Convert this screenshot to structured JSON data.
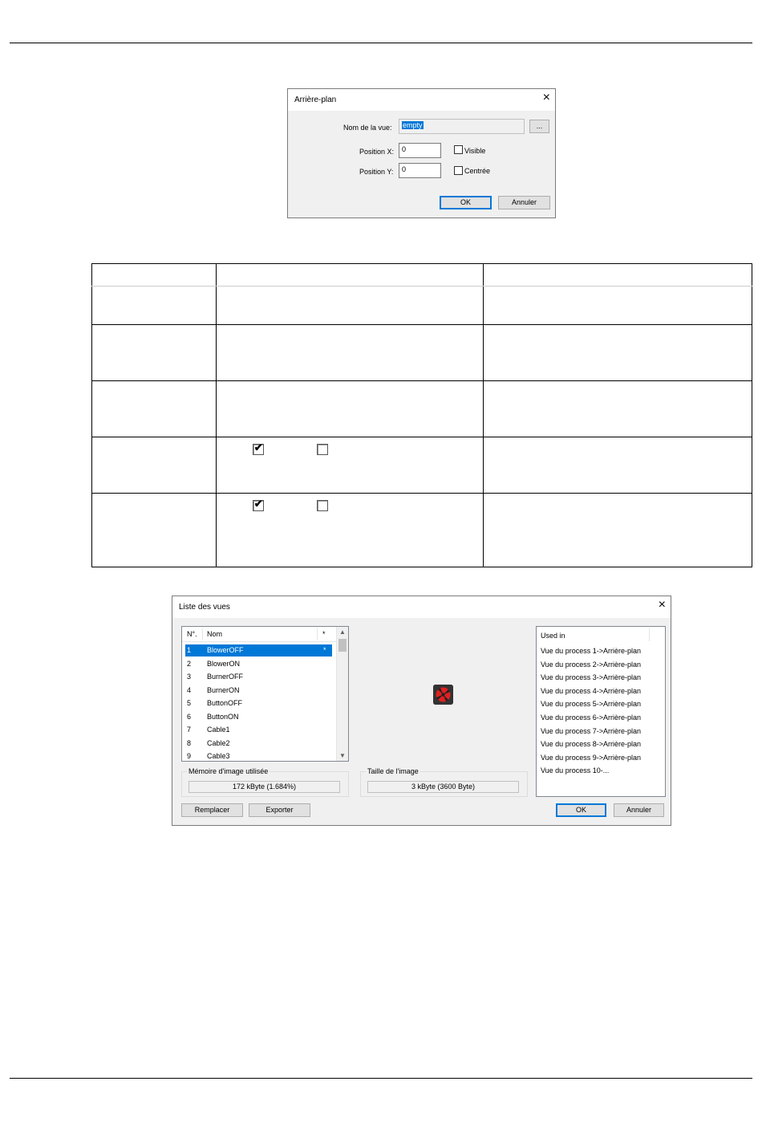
{
  "dialog_background": {
    "title": "Arrière-plan",
    "close_glyph": "×",
    "view_name_label": "Nom de la vue:",
    "view_name_value": "empty",
    "browse_label": "...",
    "pos_x_label": "Position X:",
    "pos_x_value": "0",
    "pos_y_label": "Position Y:",
    "pos_y_value": "0",
    "visible_label": "Visible",
    "visible_checked": false,
    "centered_label": "Centrée",
    "centered_checked": false,
    "ok_label": "OK",
    "cancel_label": "Annuler"
  },
  "table": {
    "checkmark": "✔",
    "rows": 6,
    "checkbox_rows": [
      {
        "first_checked": true,
        "second_checked": false
      },
      {
        "first_checked": true,
        "second_checked": false
      }
    ]
  },
  "dialog_views": {
    "title": "Liste des vues",
    "close_glyph": "×",
    "list": {
      "col_num": "N°.",
      "col_name": "Nom",
      "col_flag": "*",
      "rows": [
        {
          "num": "1",
          "name": "BlowerOFF",
          "flag": "*",
          "selected": true
        },
        {
          "num": "2",
          "name": "BlowerON",
          "flag": "",
          "selected": false
        },
        {
          "num": "3",
          "name": "BurnerOFF",
          "flag": "",
          "selected": false
        },
        {
          "num": "4",
          "name": "BurnerON",
          "flag": "",
          "selected": false
        },
        {
          "num": "5",
          "name": "ButtonOFF",
          "flag": "",
          "selected": false
        },
        {
          "num": "6",
          "name": "ButtonON",
          "flag": "",
          "selected": false
        },
        {
          "num": "7",
          "name": "Cable1",
          "flag": "",
          "selected": false
        },
        {
          "num": "8",
          "name": "Cable2",
          "flag": "",
          "selected": false
        },
        {
          "num": "9",
          "name": "Cable3",
          "flag": "",
          "selected": false
        }
      ]
    },
    "memory_label": "Mémoire d'image utilisée",
    "memory_value": "172 kByte (1.684%)",
    "size_label": "Taille de l'image",
    "size_value": "3 kByte (3600 Byte)",
    "used_in_header": "Used in",
    "used_in": [
      "Vue du process 1->Arrière-plan",
      "Vue du process 2->Arrière-plan",
      "Vue du process 3->Arrière-plan",
      "Vue du process 4->Arrière-plan",
      "Vue du process 5->Arrière-plan",
      "Vue du process 6->Arrière-plan",
      "Vue du process 7->Arrière-plan",
      "Vue du process 8->Arrière-plan",
      "Vue du process 9->Arrière-plan",
      "Vue du process 10-..."
    ],
    "replace_label": "Remplacer",
    "export_label": "Exporter",
    "ok_label": "OK",
    "cancel_label": "Annuler",
    "preview_icon": "blower-off-icon",
    "colors": {
      "selection": "#0078d7",
      "preview_bg": "#333333",
      "preview_fan": "#e02020"
    }
  }
}
